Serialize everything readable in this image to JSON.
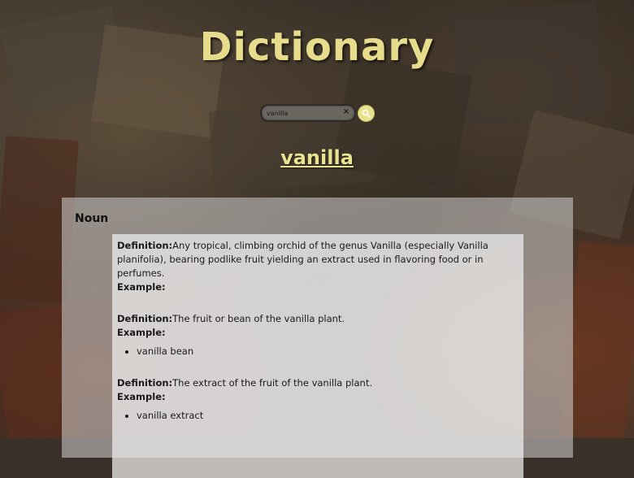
{
  "header": {
    "title": "Dictionary"
  },
  "search": {
    "value": "vanilla",
    "clear_icon": "×"
  },
  "result": {
    "word": "vanilla",
    "part_of_speech": "Noun",
    "labels": {
      "definition": "Definition:",
      "example": "Example:"
    },
    "definitions": [
      {
        "text": "Any tropical, climbing orchid of the genus Vanilla (especially Vanilla planifolia), bearing podlike fruit yielding an extract used in flavoring food or in perfumes.",
        "examples": []
      },
      {
        "text": "The fruit or bean of the vanilla plant.",
        "examples": [
          "vanilla bean"
        ]
      },
      {
        "text": "The extract of the fruit of the vanilla plant.",
        "examples": [
          "vanilla extract"
        ]
      }
    ]
  },
  "colors": {
    "accent": "#e9e28f",
    "title": "#e6dc8c"
  }
}
